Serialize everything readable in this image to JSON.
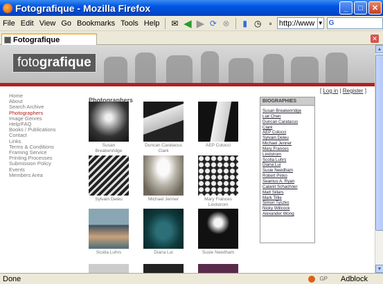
{
  "window": {
    "title": "Fotografique - Mozilla Firefox"
  },
  "menu": [
    "File",
    "Edit",
    "View",
    "Go",
    "Bookmarks",
    "Tools",
    "Help"
  ],
  "toolbar": {
    "url": "http://www"
  },
  "tab": {
    "label": "Fotografique"
  },
  "site": {
    "logo_light": "foto",
    "logo_bold": "grafique",
    "login": "Log in",
    "register": "Register",
    "nav": [
      "Home",
      "About",
      "Search Archive",
      "Photographers",
      "Image Genres",
      "Help/FAQ",
      "Books / Publications",
      "Contact",
      "Links",
      "Terms & Conditions",
      "Framing Service",
      "Printing Processes",
      "Submission Policy",
      "Events",
      "Members Area"
    ],
    "nav_active": "Photographers",
    "section_title": "Photographers",
    "photos": [
      {
        "name": "Susan Breakenridge",
        "lines": [
          "Susan",
          "Breakenridge"
        ]
      },
      {
        "name": "Duncan Caratacus Clark",
        "lines": [
          "Duncan Caratacus",
          "Clark"
        ]
      },
      {
        "name": "AEP Colocci",
        "lines": [
          "AEP Colocci"
        ]
      },
      {
        "name": "Sylvain Deleu",
        "lines": [
          "Sylvain Deleu"
        ]
      },
      {
        "name": "Michael Jenner",
        "lines": [
          "Michael Jenner"
        ]
      },
      {
        "name": "Mary Frances Lindstrom",
        "lines": [
          "Mary Frances",
          "Lindstrom"
        ]
      },
      {
        "name": "Scotia Luhrs",
        "lines": [
          "Scotia Luhrs"
        ]
      },
      {
        "name": "Diana Lui",
        "lines": [
          "Diana Lui"
        ]
      },
      {
        "name": "Susie Needham",
        "lines": [
          "Susie Needham"
        ]
      }
    ],
    "bios_title": "BIOGRAPHIES",
    "bios": [
      "Susan Breakenridge",
      "Liat Chen",
      "Duncan Caratacus",
      "Clark",
      "AEP Colocci",
      "Sylvain Deleu",
      "Michael Jenner",
      "Mary Frances",
      "Lindstrom",
      "Scotia Luhrs",
      "Diana Lui",
      "Susie Needham",
      "Robert Pinko",
      "Seamus A. Ryan",
      "Calanit Schachner",
      "Matt Sillars",
      "Mark Tillie",
      "Simon Tyszko",
      "Nicky Willcock",
      "Alexander Wong"
    ]
  },
  "status": {
    "text": "Done",
    "gp": "GP",
    "adblock": "Adblock"
  }
}
